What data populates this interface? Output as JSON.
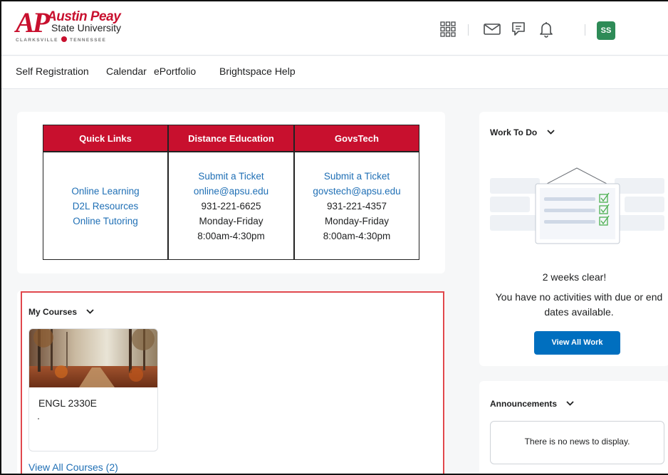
{
  "header": {
    "logo": {
      "mark": "AP",
      "name": "Austin Peay",
      "sub": "State University",
      "city_left": "CLARKSVILLE",
      "city_right": "TENNESSEE"
    },
    "icons": [
      "grid-icon",
      "mail-icon",
      "chat-icon",
      "bell-icon"
    ],
    "avatar_initials": "SS",
    "accent_color": "#c8102e"
  },
  "nav": {
    "items": [
      "Self Registration",
      "Calendar",
      "ePortfolio",
      "Brightspace Help"
    ]
  },
  "quick_links": {
    "columns": [
      {
        "header": "Quick Links",
        "links": [
          "Online Learning",
          "D2L Resources",
          "Online Tutoring"
        ],
        "lines": []
      },
      {
        "header": "Distance Education",
        "links": [
          "Submit a Ticket",
          "online@apsu.edu"
        ],
        "lines": [
          "931-221-6625",
          "Monday-Friday",
          "8:00am-4:30pm"
        ]
      },
      {
        "header": "GovsTech",
        "links": [
          "Submit a Ticket",
          "govstech@apsu.edu"
        ],
        "lines": [
          "931-221-4357",
          "Monday-Friday",
          "8:00am-4:30pm"
        ]
      }
    ]
  },
  "my_courses": {
    "title": "My Courses",
    "courses": [
      {
        "code": "ENGL 2330E",
        "subtitle": "."
      }
    ],
    "view_all": "View All Courses (2)"
  },
  "work_to_do": {
    "title": "Work To Do",
    "status": "2 weeks clear!",
    "message": "You have no activities with due or end dates available.",
    "button": "View All Work"
  },
  "announcements": {
    "title": "Announcements",
    "empty": "There is no news to display."
  }
}
